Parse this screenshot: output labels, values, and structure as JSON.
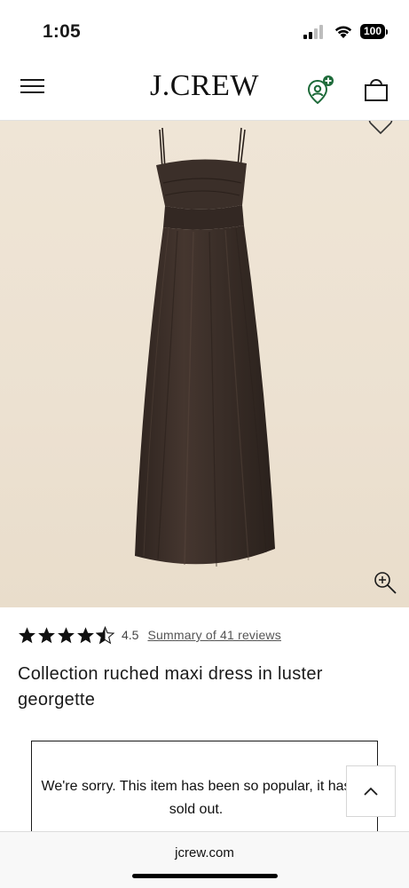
{
  "status_bar": {
    "time": "1:05",
    "battery": "100",
    "icons": [
      "signal-icon",
      "wifi-icon",
      "battery-icon"
    ]
  },
  "header": {
    "brand": "J.CREW",
    "icons": [
      "hamburger-menu-icon",
      "rewards-profile-icon",
      "shopping-bag-icon"
    ],
    "accent_color": "#1e6b3a"
  },
  "product": {
    "image_icons": [
      "heart-icon",
      "zoom-in-icon"
    ],
    "image_background": "#ece1d1",
    "dress_color": "#3a2e28",
    "rating": {
      "stars_value": 4.5,
      "value_text": "4.5",
      "reviews_link": "Summary of 41 reviews"
    },
    "title": "Collection ruched maxi dress in luster georgette"
  },
  "notice": {
    "message": "We're sorry. This item has been so popular, it has sold out."
  },
  "back_to_top": {
    "icon": "chevron-up-icon"
  },
  "browser": {
    "url": "jcrew.com"
  }
}
